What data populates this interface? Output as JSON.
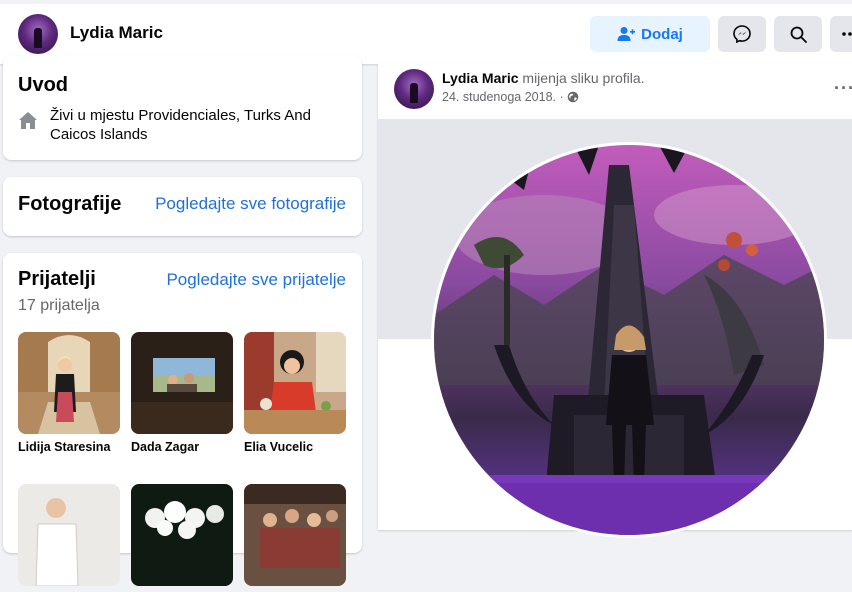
{
  "header": {
    "name": "Lydia Maric",
    "add_label": "Dodaj"
  },
  "intro": {
    "title": "Uvod",
    "lives_prefix": "Živi u mjestu ",
    "lives_place": "Providenciales, Turks And Caicos Islands"
  },
  "photos": {
    "title": "Fotografije",
    "link": "Pogledajte sve fotografije"
  },
  "friends": {
    "title": "Prijatelji",
    "link": "Pogledajte sve prijatelje",
    "count": "17 prijatelja",
    "items": [
      {
        "name": "Lidija Staresina"
      },
      {
        "name": "Dada Zagar"
      },
      {
        "name": "Elia Vucelic"
      },
      {
        "name": ""
      },
      {
        "name": ""
      },
      {
        "name": ""
      }
    ]
  },
  "post": {
    "author": "Lydia Maric",
    "action": " mijenja sliku profila.",
    "date": "24. studenoga 2018. ·"
  },
  "colors": {
    "accent": "#1877f2",
    "link": "#216fdb",
    "secondary_text": "#65676b"
  },
  "icons": [
    "add-friend-icon",
    "messenger-icon",
    "search-icon",
    "more-icon",
    "home-icon",
    "globe-icon"
  ]
}
